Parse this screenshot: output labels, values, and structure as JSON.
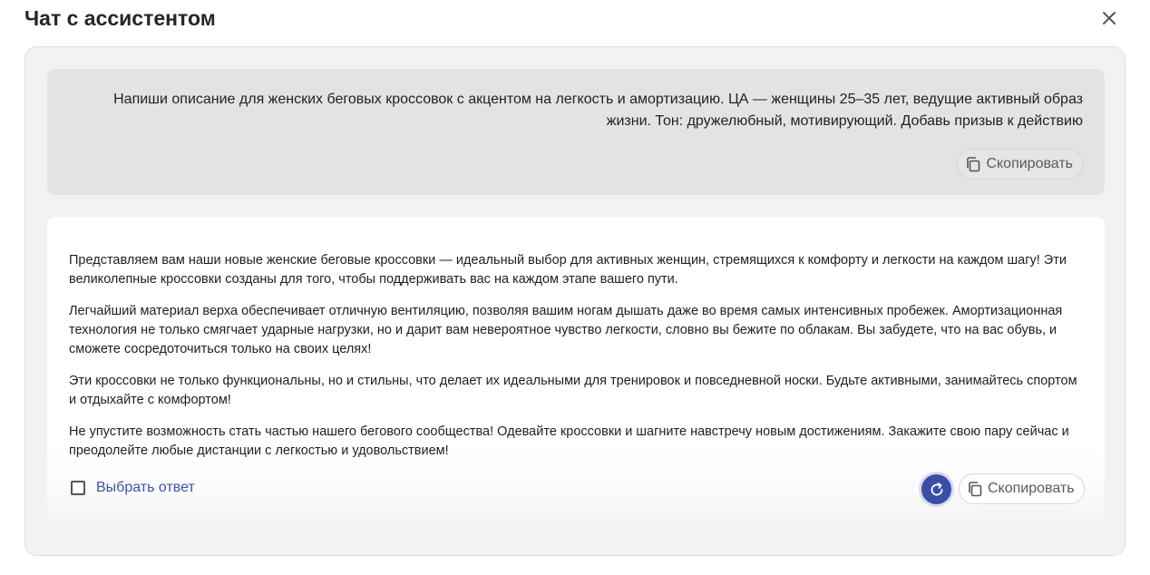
{
  "modal": {
    "title": "Чат с ассистентом"
  },
  "user_message": {
    "text": "Напиши описание для женских беговых кроссовок с акцентом на легкость и амортизацию. ЦА — женщины 25–35 лет, ведущие активный образ жизни. Тон: дружелюбный, мотивирующий. Добавь призыв к действию",
    "copy_label": "Скопировать"
  },
  "assistant_message": {
    "paragraphs": [
      "Представляем вам наши новые женские беговые кроссовки — идеальный выбор для активных женщин, стремящихся к комфорту и легкости на каждом шагу! Эти великолепные кроссовки созданы для того, чтобы поддерживать вас на каждом этапе вашего пути.",
      "Легчайший материал верха обеспечивает отличную вентиляцию, позволяя вашим ногам дышать даже во время самых интенсивных пробежек. Амортизационная технология не только смягчает ударные нагрузки, но и дарит вам невероятное чувство легкости, словно вы бежите по облакам. Вы забудете, что на вас обувь, и сможете сосредоточиться только на своих целях!",
      "Эти кроссовки не только функциональны, но и стильны, что делает их идеальными для тренировок и повседневной носки. Будьте активными, занимайтесь спортом и отдыхайте с комфортом!",
      "Не упустите возможность стать частью нашего бегового сообщества! Одевайте кроссовки и шагните навстречу новым достижениям. Закажите свою пару сейчас и преодолейте любые дистанции с легкостью и удовольствием!"
    ],
    "select_label": "Выбрать ответ",
    "select_checked": false,
    "copy_label": "Скопировать"
  },
  "icons": {
    "close": "close-icon",
    "copy": "copy-icon",
    "regenerate": "refresh-icon"
  },
  "colors": {
    "accent": "#3b4ea6",
    "link": "#3f51a8",
    "user_bubble": "#e3e3e3",
    "panel": "#f2f2f2"
  }
}
